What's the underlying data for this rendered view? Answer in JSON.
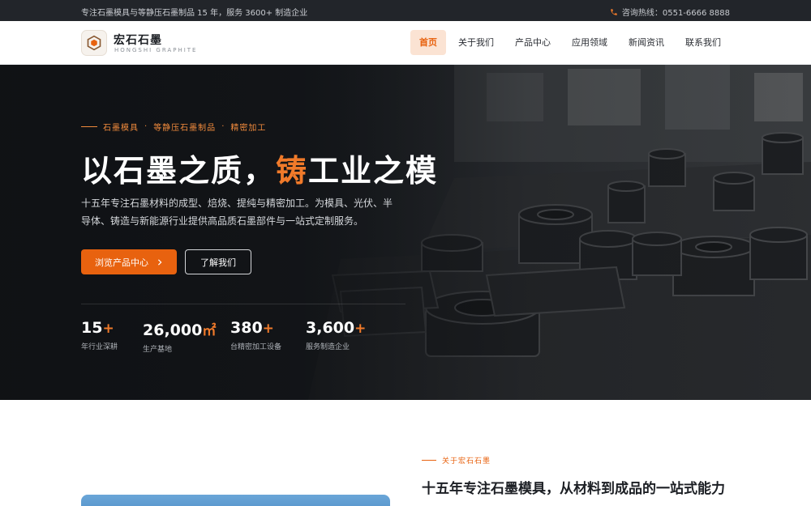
{
  "topbar": {
    "tagline": "专注石墨模具与等静压石墨制品 15 年，服务 3600+ 制造企业",
    "hotline": "咨询热线：0551-6666 8888",
    "icon": "phone-icon"
  },
  "brand": {
    "name": "宏石石墨",
    "subtitle": "HONGSHI GRAPHITE",
    "icon": "hexagon-logo-icon"
  },
  "nav": {
    "items": [
      {
        "label": "首页",
        "active": true
      },
      {
        "label": "关于我们",
        "active": false
      },
      {
        "label": "产品中心",
        "active": false
      },
      {
        "label": "应用领域",
        "active": false
      },
      {
        "label": "新闻资讯",
        "active": false
      },
      {
        "label": "联系我们",
        "active": false
      }
    ]
  },
  "hero": {
    "eyebrow": [
      "石墨模具",
      "等静压石墨制品",
      "精密加工"
    ],
    "eyebrow_separator": "·",
    "title_before": "以石墨之质，",
    "title_accent": "铸",
    "title_after": "工业之模",
    "description": "十五年专注石墨材料的成型、焙烧、提纯与精密加工。为模具、光伏、半导体、铸造与新能源行业提供高品质石墨部件与一站式定制服务。",
    "primary_button": "浏览产品中心",
    "primary_button_icon": "chevron-right-icon",
    "secondary_button": "了解我们",
    "stats": [
      {
        "value": "15",
        "suffix": "+",
        "label": "年行业深耕"
      },
      {
        "value": "26,000",
        "suffix": "㎡",
        "label": "生产基地"
      },
      {
        "value": "380",
        "suffix": "+",
        "label": "台精密加工设备"
      },
      {
        "value": "3,600",
        "suffix": "+",
        "label": "服务制造企业"
      }
    ]
  },
  "about": {
    "eyebrow": "关于宏石石墨",
    "title": "十五年专注石墨模具，从材料到成品的一站式能力"
  },
  "colors": {
    "accent": "#e8620f",
    "topbar_bg": "#22252a",
    "nav_active_bg": "#fbe3d3"
  }
}
